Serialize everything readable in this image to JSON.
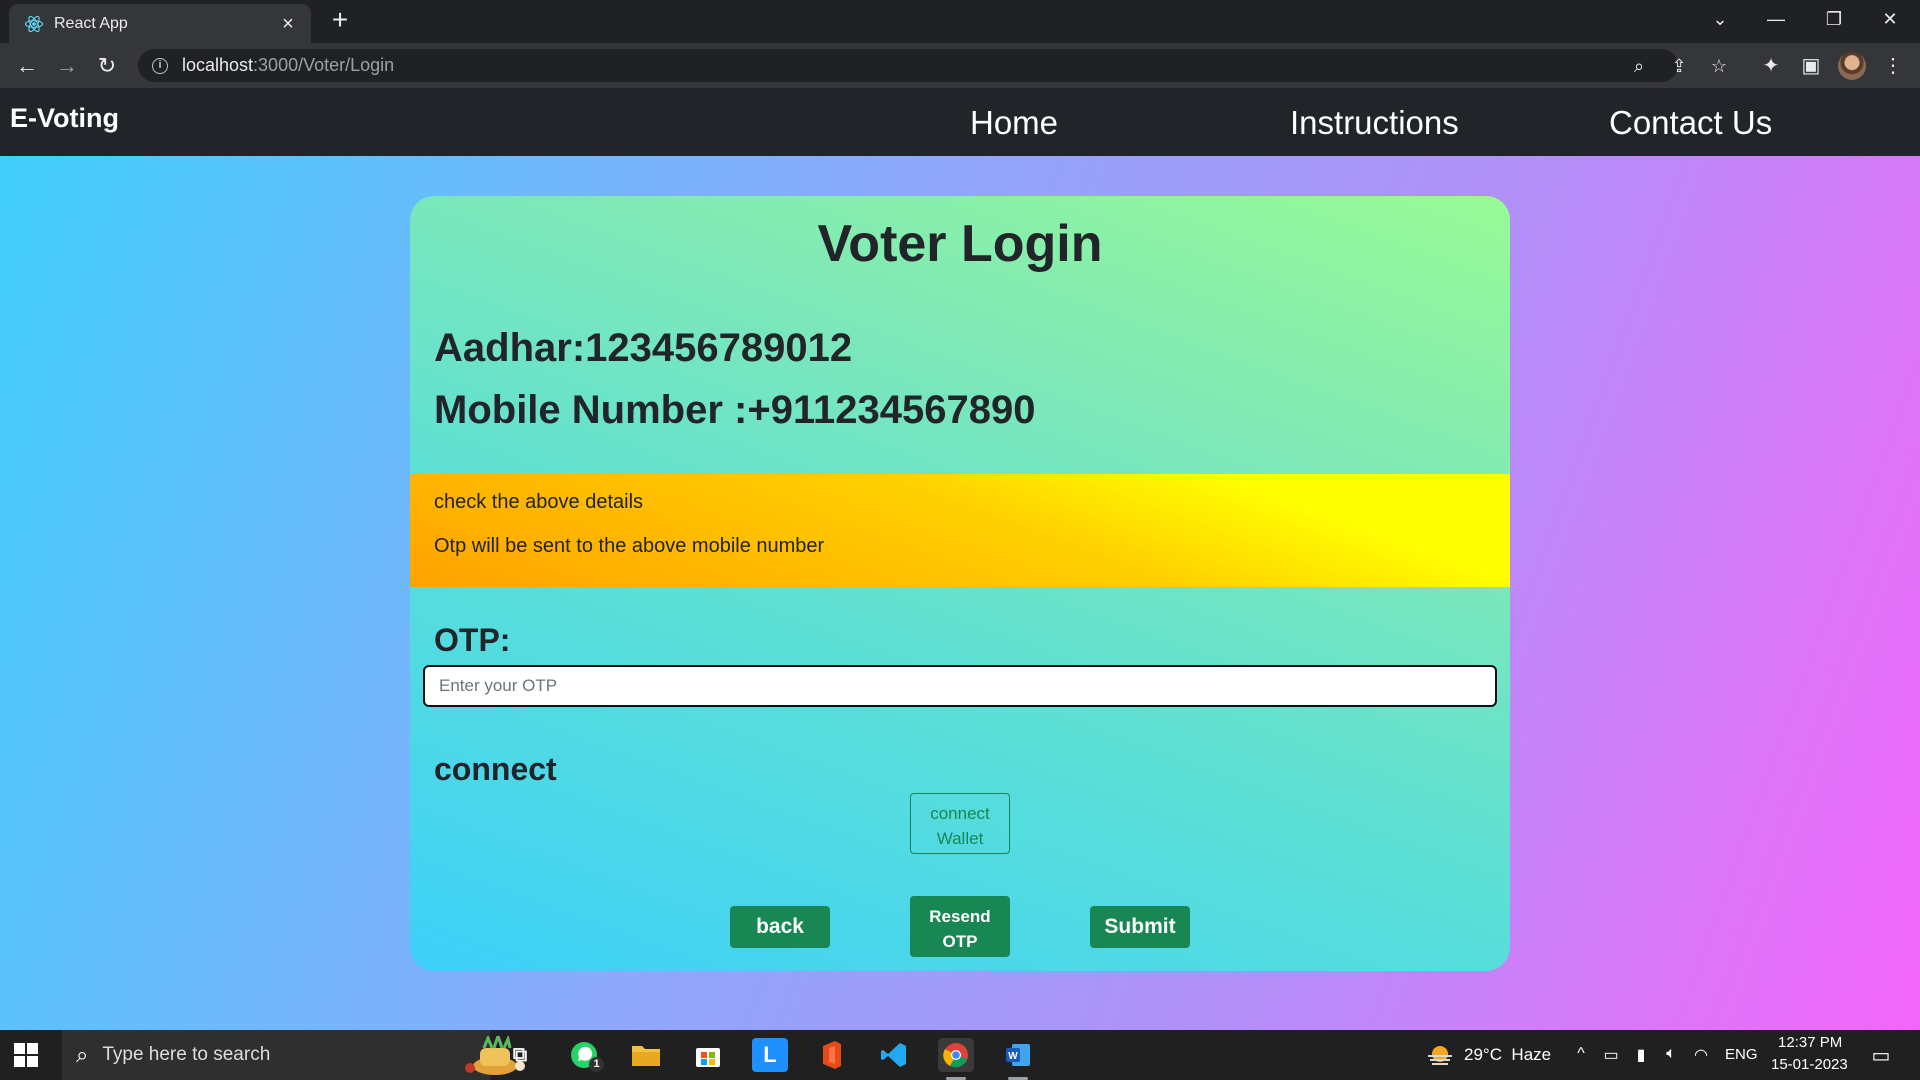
{
  "browser": {
    "tab_title": "React App",
    "url_host": "localhost",
    "url_path": ":3000/Voter/Login"
  },
  "navbar": {
    "brand": "E-Voting",
    "links": [
      "Home",
      "Instructions",
      "Contact Us"
    ]
  },
  "login": {
    "title": "Voter Login",
    "aadhar": "Aadhar:123456789012",
    "mobile": "Mobile Number :+911234567890",
    "notice_lines": [
      "check the above details",
      "Otp will be sent to the above mobile number"
    ],
    "otp_label": "OTP:",
    "otp_placeholder": "Enter your OTP",
    "otp_value": "",
    "connect_label": "connect",
    "connect_wallet_button": "connect\nWallet",
    "back_button": "back",
    "resend_button": "Resend\nOTP",
    "submit_button": "Submit"
  },
  "taskbar": {
    "search_placeholder": "Type here to search",
    "weather": "29°C  Haze",
    "language": "ENG",
    "time": "12:37 PM",
    "date": "15-01-2023",
    "whatsapp_badge": "1"
  },
  "colors": {
    "navbar": "#212529",
    "button_green": "#198754",
    "notice_yellow": "#ffd000",
    "card_cyan": "#3dd0fa",
    "card_green": "#98fa95"
  }
}
